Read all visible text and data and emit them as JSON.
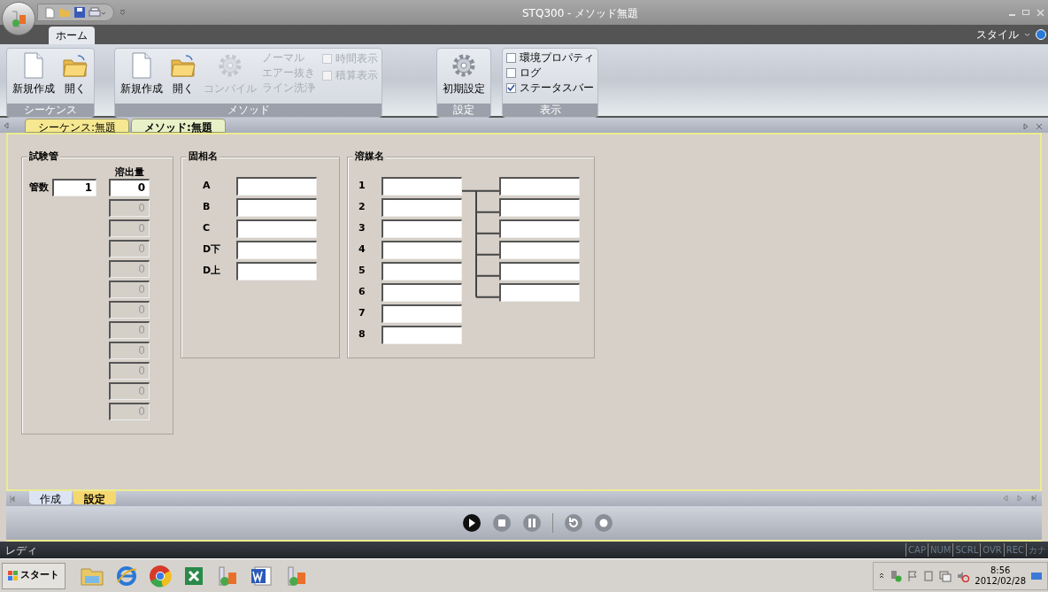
{
  "window": {
    "title": "STQ300 - メソッド無題"
  },
  "ribbon": {
    "tab": {
      "label": "ホーム",
      "selected": true
    },
    "style_menu": "スタイル",
    "sequence": {
      "label": "シーケンス",
      "buttons": [
        {
          "kind": "new",
          "label": "新規作成",
          "disabled": false
        },
        {
          "kind": "open",
          "label": "開く",
          "disabled": false
        }
      ]
    },
    "method": {
      "label": "メソッド",
      "buttons": [
        {
          "kind": "new",
          "label": "新規作成",
          "disabled": false
        },
        {
          "kind": "open",
          "label": "開く",
          "disabled": false
        },
        {
          "kind": "gear",
          "label": "コンパイル",
          "disabled": true
        }
      ],
      "modes": [
        {
          "label": "ノーマル",
          "disabled": true
        },
        {
          "label": "エアー抜き",
          "disabled": true
        },
        {
          "label": "ライン洗浄",
          "disabled": true
        }
      ],
      "toggles": [
        {
          "label": "時間表示",
          "checked": false,
          "disabled": true
        },
        {
          "label": "積算表示",
          "checked": false,
          "disabled": true
        }
      ]
    },
    "settings": {
      "label": "設定",
      "buttons": [
        {
          "kind": "gear",
          "label": "初期設定",
          "disabled": false
        }
      ]
    },
    "view": {
      "label": "表示",
      "options": [
        {
          "label": "環境プロパティ",
          "checked": false
        },
        {
          "label": "ログ",
          "checked": false
        },
        {
          "label": "ステータスバー",
          "checked": true
        }
      ]
    }
  },
  "document_tabs": [
    {
      "label": "シーケンス:無題",
      "selected": false
    },
    {
      "label": "メソッド:無題",
      "selected": true
    }
  ],
  "tubes": {
    "title": "試験管",
    "count_label": "管数",
    "count": "1",
    "elution_label": "溶出量",
    "elution": [
      {
        "value": "0",
        "disabled": false
      },
      {
        "value": "0",
        "disabled": true
      },
      {
        "value": "0",
        "disabled": true
      },
      {
        "value": "0",
        "disabled": true
      },
      {
        "value": "0",
        "disabled": true
      },
      {
        "value": "0",
        "disabled": true
      },
      {
        "value": "0",
        "disabled": true
      },
      {
        "value": "0",
        "disabled": true
      },
      {
        "value": "0",
        "disabled": true
      },
      {
        "value": "0",
        "disabled": true
      },
      {
        "value": "0",
        "disabled": true
      },
      {
        "value": "0",
        "disabled": true
      }
    ]
  },
  "solid_phase": {
    "title": "固相名",
    "rows": [
      {
        "label": "A"
      },
      {
        "label": "B"
      },
      {
        "label": "C"
      },
      {
        "label": "D下"
      },
      {
        "label": "D上"
      }
    ]
  },
  "solvents": {
    "title": "溶媒名",
    "rows": [
      {
        "label": "1",
        "branch": true
      },
      {
        "label": "2",
        "branch": true
      },
      {
        "label": "3",
        "branch": true
      },
      {
        "label": "4",
        "branch": true
      },
      {
        "label": "5",
        "branch": true
      },
      {
        "label": "6",
        "branch": true
      },
      {
        "label": "7",
        "branch": false
      },
      {
        "label": "8",
        "branch": false
      }
    ]
  },
  "bottom_tabs": [
    {
      "label": "作成",
      "selected": false
    },
    {
      "label": "設定",
      "selected": true
    }
  ],
  "transport": [
    {
      "kind": "play",
      "disabled": false
    },
    {
      "kind": "stop",
      "disabled": true
    },
    {
      "kind": "pause",
      "disabled": true
    },
    {
      "kind": "rewind",
      "disabled": true
    },
    {
      "kind": "record",
      "disabled": true
    }
  ],
  "status_bar": {
    "text": "レディ",
    "indicators": [
      "CAP",
      "NUM",
      "SCRL",
      "OVR",
      "REC",
      "カナ"
    ]
  },
  "taskbar": {
    "start": "スタート",
    "time": "8:56",
    "date": "2012/02/28"
  }
}
